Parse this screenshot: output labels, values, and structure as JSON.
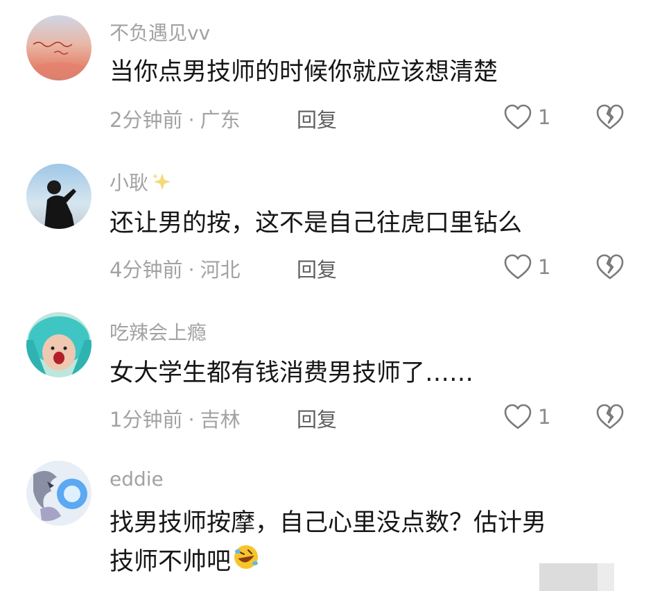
{
  "comments": [
    {
      "username": "不负遇见vv",
      "content": "当你点男技师的时候你就应该想清楚",
      "time": "2分钟前",
      "location": "广东",
      "reply_label": "回复",
      "likes": "1",
      "avatar_icon": "handwriting-avatar-icon"
    },
    {
      "username": "小耿",
      "username_decoration": "sparkle-icon",
      "content": "还让男的按，这不是自己往虎口里钻么",
      "time": "4分钟前",
      "location": "河北",
      "reply_label": "回复",
      "likes": "1",
      "avatar_icon": "person-silhouette-avatar-icon"
    },
    {
      "username": "吃辣会上瘾",
      "content": "女大学生都有钱消费男技师了……",
      "time": "1分钟前",
      "location": "吉林",
      "reply_label": "回复",
      "likes": "1",
      "avatar_icon": "blue-hair-avatar-icon"
    },
    {
      "username": "eddie",
      "content_line1": "找男技师按摩，自己心里没点数？估计男",
      "content_line2": "技师不帅吧",
      "content_emoji": "rolling-on-floor-laughing-emoji",
      "avatar_icon": "dragon-avatar-icon"
    }
  ],
  "meta_separator": "·",
  "colors": {
    "text_primary": "#161616",
    "text_secondary": "#a2a2a2",
    "reply_text": "#5f5f5f",
    "icon_stroke": "#7a7a7a"
  }
}
